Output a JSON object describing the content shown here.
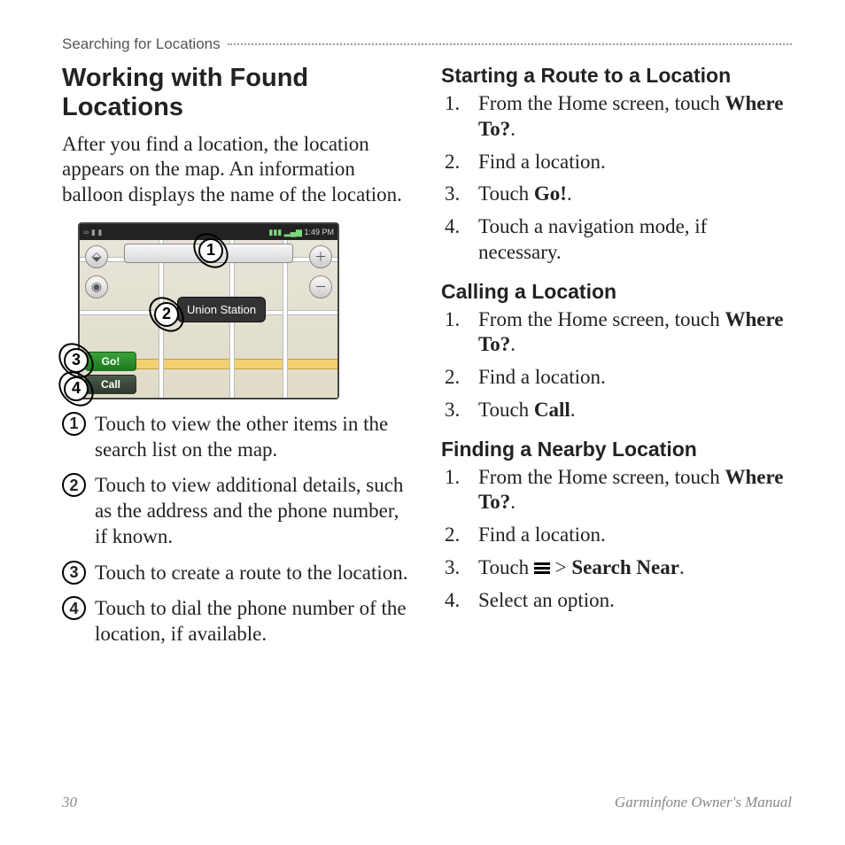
{
  "header": "Searching for Locations",
  "left": {
    "h1": "Working with Found Locations",
    "intro": "After you find a location, the location appears on the map. An information balloon displays the name of the location.",
    "screenshot": {
      "time": "1:49 PM",
      "bubble": "Union Station",
      "go_label": "Go!",
      "call_label": "Call",
      "callouts": {
        "c1": "1",
        "c2": "2",
        "c3": "3",
        "c4": "4"
      }
    },
    "legend": [
      {
        "num": "1",
        "text": "Touch to view the other items in the search list on the map."
      },
      {
        "num": "2",
        "text": "Touch to view additional details, such as the address and the phone number, if known."
      },
      {
        "num": "3",
        "text": "Touch to create a route to the location."
      },
      {
        "num": "4",
        "text": "Touch to dial the phone number of the location, if available."
      }
    ]
  },
  "right": {
    "sections": [
      {
        "title": "Starting a Route to a Location",
        "steps": [
          {
            "pre": "From the Home screen, touch ",
            "bold": "Where To?",
            "post": "."
          },
          {
            "text": "Find a location."
          },
          {
            "pre": "Touch ",
            "bold": "Go!",
            "post": "."
          },
          {
            "text": "Touch a navigation mode, if necessary."
          }
        ]
      },
      {
        "title": "Calling a Location",
        "steps": [
          {
            "pre": "From the Home screen, touch ",
            "bold": "Where To?",
            "post": "."
          },
          {
            "text": "Find a location."
          },
          {
            "pre": "Touch ",
            "bold": "Call",
            "post": "."
          }
        ]
      },
      {
        "title": "Finding a Nearby Location",
        "steps": [
          {
            "pre": "From the Home screen, touch ",
            "bold": "Where To?",
            "post": "."
          },
          {
            "text": "Find a location."
          },
          {
            "pre": "Touch ",
            "icon": true,
            "mid": " > ",
            "bold": "Search Near",
            "post": "."
          },
          {
            "text": "Select an option."
          }
        ]
      }
    ]
  },
  "footer": {
    "page": "30",
    "manual": "Garminfone Owner's Manual"
  }
}
